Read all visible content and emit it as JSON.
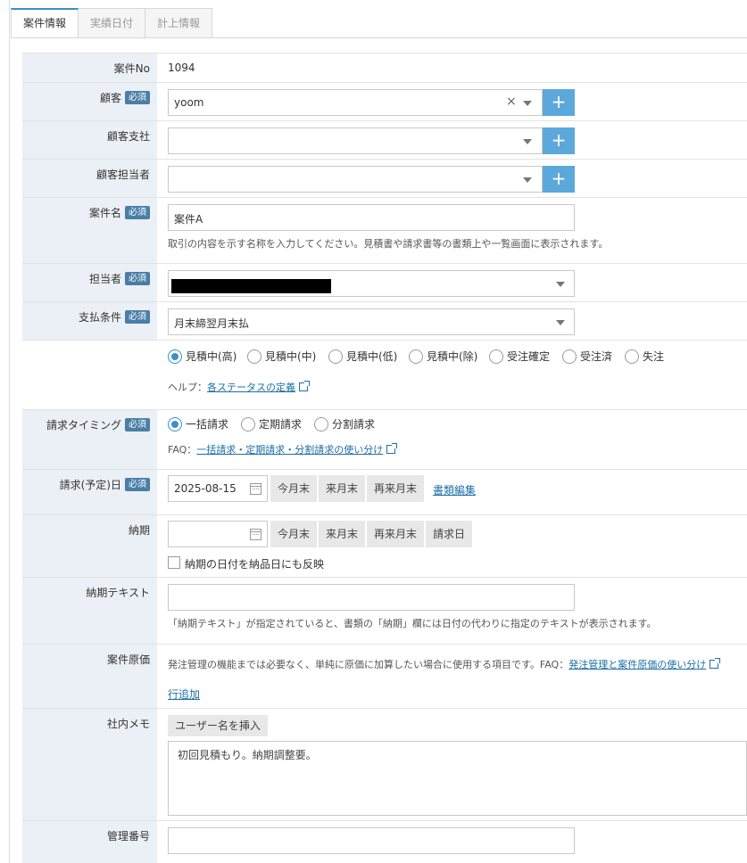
{
  "tabs": [
    {
      "label": "案件情報",
      "active": true
    },
    {
      "label": "実績日付",
      "active": false
    },
    {
      "label": "計上情報",
      "active": false
    }
  ],
  "required_label": "必須",
  "case_no": {
    "label": "案件No",
    "value": "1094"
  },
  "customer": {
    "label": "顧客",
    "value": "yoom",
    "clear_icon": "×"
  },
  "customer_branch": {
    "label": "顧客支社",
    "value": ""
  },
  "customer_contact": {
    "label": "顧客担当者",
    "value": ""
  },
  "case_name": {
    "label": "案件名",
    "value": "案件A",
    "hint": "取引の内容を示す名称を入力してください。見積書や請求書等の書類上や一覧画面に表示されます。"
  },
  "assignee": {
    "label": "担当者",
    "value": ""
  },
  "payment_terms": {
    "label": "支払条件",
    "value": "月末締翌月末払"
  },
  "status": {
    "options": [
      "見積中(高)",
      "見積中(中)",
      "見積中(低)",
      "見積中(除)",
      "受注確定",
      "受注済",
      "失注"
    ],
    "selected": "見積中(高)",
    "help_prefix": "ヘルプ：",
    "help_link": "各ステータスの定義"
  },
  "billing_timing": {
    "label": "請求タイミング",
    "options": [
      "一括請求",
      "定期請求",
      "分割請求"
    ],
    "selected": "一括請求",
    "faq_prefix": "FAQ：",
    "faq_link": "一括請求・定期請求・分割請求の使い分け"
  },
  "billing_date": {
    "label": "請求(予定)日",
    "value": "2025-08-15",
    "buttons": [
      "今月末",
      "来月末",
      "再来月末"
    ],
    "doc_edit_link": "書類編集"
  },
  "delivery": {
    "label": "納期",
    "value": "",
    "buttons": [
      "今月末",
      "来月末",
      "再来月末",
      "請求日"
    ],
    "reflect_label": "納期の日付を納品日にも反映"
  },
  "delivery_text": {
    "label": "納期テキスト",
    "value": "",
    "hint": "「納期テキスト」が指定されていると、書類の「納期」欄には日付の代わりに指定のテキストが表示されます。"
  },
  "case_cost": {
    "label": "案件原価",
    "hint_prefix": "発注管理の機能までは必要なく、単純に原価に加算したい場合に使用する項目です。FAQ：",
    "hint_link": "発注管理と案件原価の使い分け",
    "add_row": "行追加"
  },
  "internal_memo": {
    "label": "社内メモ",
    "insert_button": "ユーザー名を挿入",
    "value": "初回見積もり。納期調整要。"
  },
  "management_no": {
    "label": "管理番号",
    "value": ""
  },
  "colors": {
    "accent": "#3a8fc9",
    "plus": "#5ca8db",
    "label_bg": "#eaf0f5",
    "badge": "#4a7ea6"
  }
}
